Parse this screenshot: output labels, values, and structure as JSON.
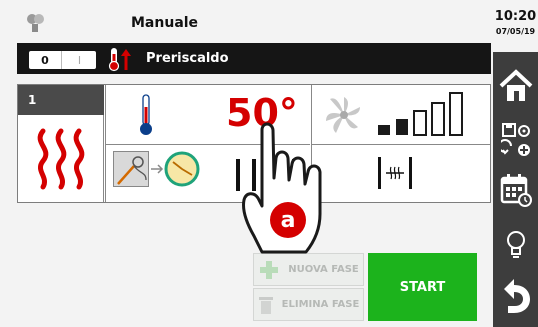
{
  "header": {
    "title": "Manuale",
    "time": "10:20",
    "date": "07/05/19"
  },
  "preheat_bar": {
    "toggle_on": "0",
    "toggle_off": "I",
    "label": "Preriscaldo"
  },
  "phase": {
    "number": "1",
    "temperature": "50°"
  },
  "actions": {
    "add_phase": "NUOVA FASE",
    "delete_phase": "ELIMINA FASE",
    "start": "START"
  },
  "hand_badge": "a",
  "colors": {
    "accent_red": "#d40000",
    "start_green": "#1cb31c",
    "sidebar_dark": "#3d3d3d",
    "bar_dark": "#151515"
  },
  "icons": [
    "user-icon",
    "thermometer-icon",
    "heat-icon",
    "fan-icon",
    "signal-bars-icon",
    "clock-icon",
    "probe-icon",
    "vent-icon",
    "home-icon",
    "save-settings-icon",
    "calendar-icon",
    "bulb-icon",
    "back-icon",
    "hand-pointer-icon"
  ]
}
